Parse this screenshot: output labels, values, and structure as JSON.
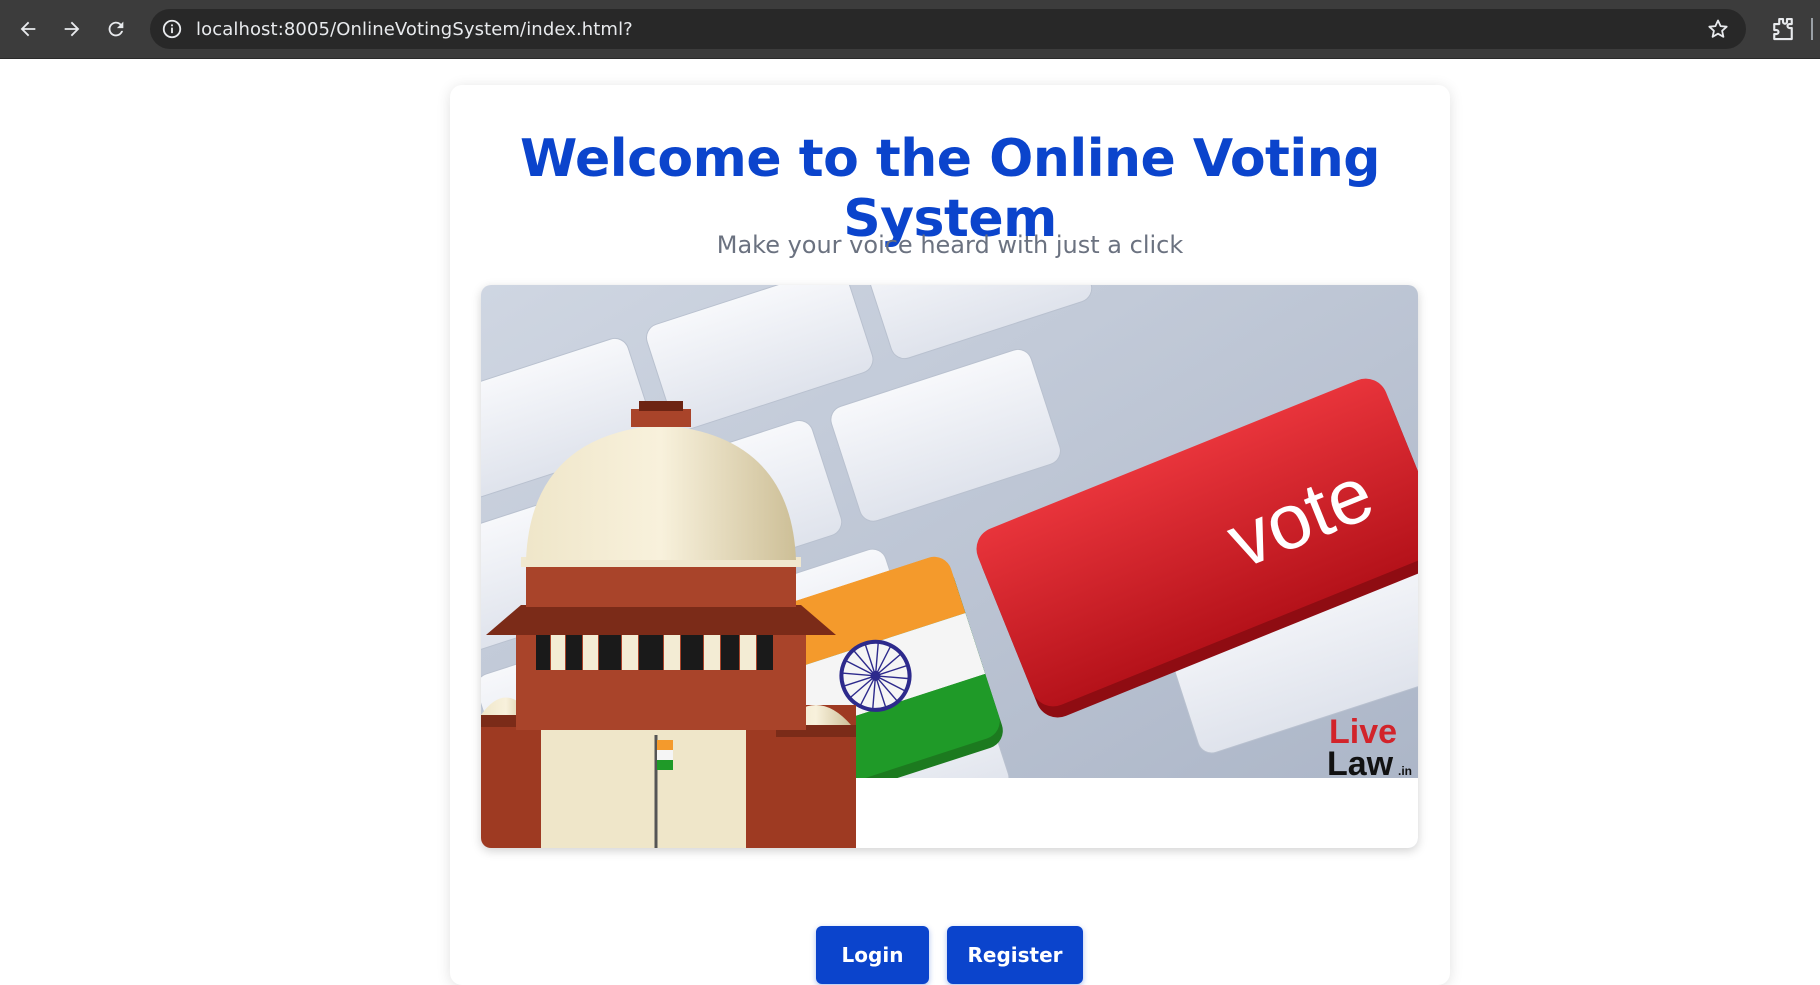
{
  "browser": {
    "url": "localhost:8005/OnlineVotingSystem/index.html?",
    "back_icon": "back-arrow-icon",
    "forward_icon": "forward-arrow-icon",
    "reload_icon": "reload-icon",
    "info_icon": "info-icon",
    "bookmark_icon": "star-icon",
    "extensions_icon": "puzzle-icon"
  },
  "page": {
    "title": "Welcome to the Online Voting System",
    "subtitle": "Make your voice heard with just a click",
    "hero": {
      "key_label": "vote",
      "logo_top": "Live",
      "logo_bottom": "Law",
      "logo_suffix": ".in"
    },
    "buttons": {
      "login": "Login",
      "register": "Register"
    }
  },
  "colors": {
    "accent": "#0b44cc",
    "subtitle": "#6b7280",
    "chrome": "#3c3c3c",
    "vote_key": "#d61f26"
  }
}
